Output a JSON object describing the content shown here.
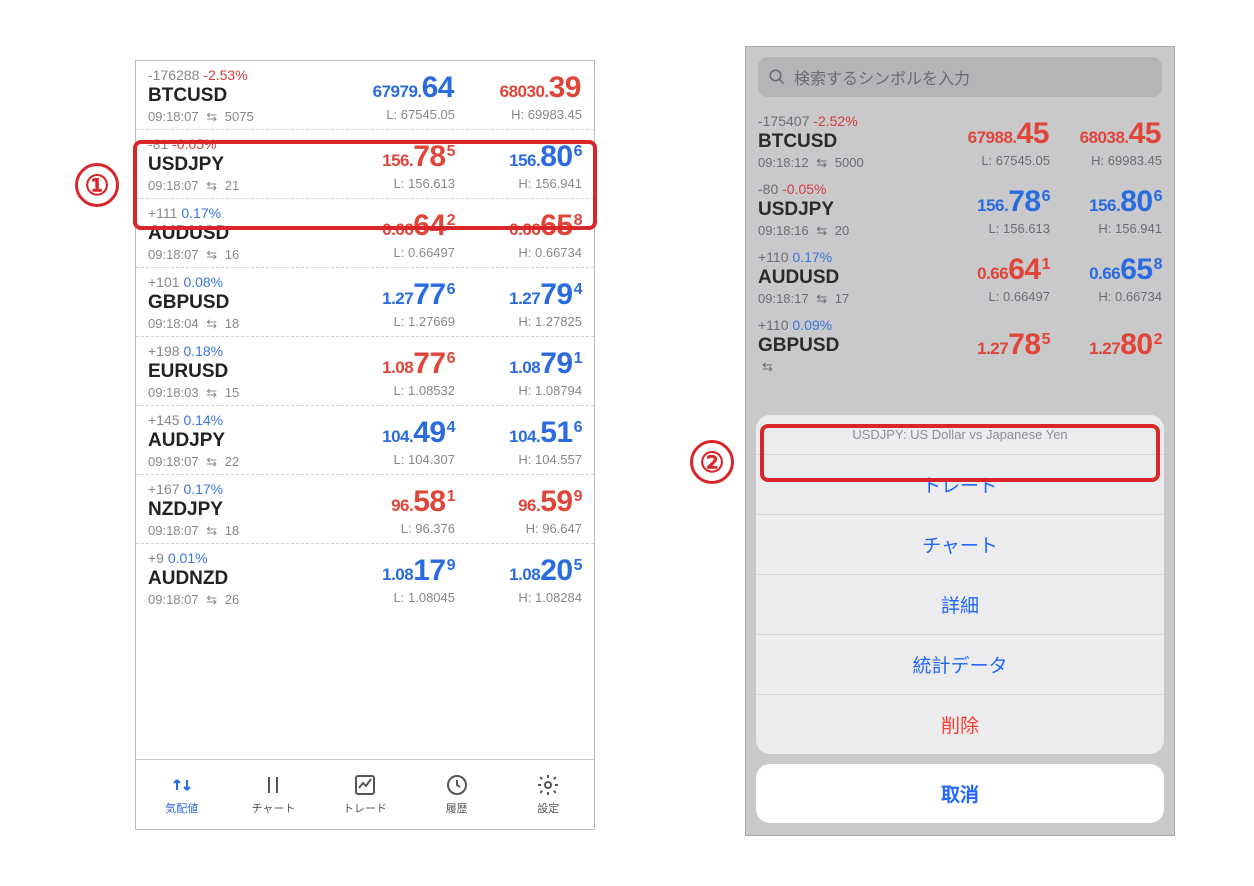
{
  "annotations": {
    "one": "①",
    "two": "②"
  },
  "phone1": {
    "rows": [
      {
        "chg": "-176288",
        "pct": "-2.53%",
        "pcls": "neg",
        "sym": "BTCUSD",
        "time": "09:18:07",
        "spread": "5075",
        "sell_pre": "67979.",
        "sell_main": "64",
        "sell_sup": "",
        "sell_cls": "blue",
        "buy_pre": "68030.",
        "buy_main": "39",
        "buy_sup": "",
        "buy_cls": "red",
        "low": "L: 67545.05",
        "high": "H: 69983.45"
      },
      {
        "chg": "-81",
        "pct": "-0.05%",
        "pcls": "neg",
        "sym": "USDJPY",
        "time": "09:18:07",
        "spread": "21",
        "sell_pre": "156.",
        "sell_main": "78",
        "sell_sup": "5",
        "sell_cls": "red",
        "buy_pre": "156.",
        "buy_main": "80",
        "buy_sup": "6",
        "buy_cls": "blue",
        "low": "L: 156.613",
        "high": "H: 156.941"
      },
      {
        "chg": "+111",
        "pct": "0.17%",
        "pcls": "pos",
        "sym": "AUDUSD",
        "time": "09:18:07",
        "spread": "16",
        "sell_pre": "0.66",
        "sell_main": "64",
        "sell_sup": "2",
        "sell_cls": "red",
        "buy_pre": "0.66",
        "buy_main": "65",
        "buy_sup": "8",
        "buy_cls": "red",
        "low": "L: 0.66497",
        "high": "H: 0.66734"
      },
      {
        "chg": "+101",
        "pct": "0.08%",
        "pcls": "pos",
        "sym": "GBPUSD",
        "time": "09:18:04",
        "spread": "18",
        "sell_pre": "1.27",
        "sell_main": "77",
        "sell_sup": "6",
        "sell_cls": "blue",
        "buy_pre": "1.27",
        "buy_main": "79",
        "buy_sup": "4",
        "buy_cls": "blue",
        "low": "L: 1.27669",
        "high": "H: 1.27825"
      },
      {
        "chg": "+198",
        "pct": "0.18%",
        "pcls": "pos",
        "sym": "EURUSD",
        "time": "09:18:03",
        "spread": "15",
        "sell_pre": "1.08",
        "sell_main": "77",
        "sell_sup": "6",
        "sell_cls": "red",
        "buy_pre": "1.08",
        "buy_main": "79",
        "buy_sup": "1",
        "buy_cls": "blue",
        "low": "L: 1.08532",
        "high": "H: 1.08794"
      },
      {
        "chg": "+145",
        "pct": "0.14%",
        "pcls": "pos",
        "sym": "AUDJPY",
        "time": "09:18:07",
        "spread": "22",
        "sell_pre": "104.",
        "sell_main": "49",
        "sell_sup": "4",
        "sell_cls": "blue",
        "buy_pre": "104.",
        "buy_main": "51",
        "buy_sup": "6",
        "buy_cls": "blue",
        "low": "L: 104.307",
        "high": "H: 104.557"
      },
      {
        "chg": "+167",
        "pct": "0.17%",
        "pcls": "pos",
        "sym": "NZDJPY",
        "time": "09:18:07",
        "spread": "18",
        "sell_pre": "96.",
        "sell_main": "58",
        "sell_sup": "1",
        "sell_cls": "red",
        "buy_pre": "96.",
        "buy_main": "59",
        "buy_sup": "9",
        "buy_cls": "red",
        "low": "L: 96.376",
        "high": "H: 96.647"
      },
      {
        "chg": "+9",
        "pct": "0.01%",
        "pcls": "pos",
        "sym": "AUDNZD",
        "time": "09:18:07",
        "spread": "26",
        "sell_pre": "1.08",
        "sell_main": "17",
        "sell_sup": "9",
        "sell_cls": "blue",
        "buy_pre": "1.08",
        "buy_main": "20",
        "buy_sup": "5",
        "buy_cls": "blue",
        "low": "L: 1.08045",
        "high": "H: 1.08284"
      }
    ],
    "tabs": {
      "quotes": "気配値",
      "chart": "チャート",
      "trade": "トレード",
      "history": "履歴",
      "settings": "設定"
    }
  },
  "phone2": {
    "search_placeholder": "検索するシンボルを入力",
    "rows": [
      {
        "chg": "-175407",
        "pct": "-2.52%",
        "pcls": "neg",
        "sym": "BTCUSD",
        "time": "09:18:12",
        "spread": "5000",
        "sell_pre": "67988.",
        "sell_main": "45",
        "sell_sup": "",
        "sell_cls": "red",
        "buy_pre": "68038.",
        "buy_main": "45",
        "buy_sup": "",
        "buy_cls": "red",
        "low": "L: 67545.05",
        "high": "H: 69983.45"
      },
      {
        "chg": "-80",
        "pct": "-0.05%",
        "pcls": "neg",
        "sym": "USDJPY",
        "time": "09:18:16",
        "spread": "20",
        "sell_pre": "156.",
        "sell_main": "78",
        "sell_sup": "6",
        "sell_cls": "blue",
        "buy_pre": "156.",
        "buy_main": "80",
        "buy_sup": "6",
        "buy_cls": "blue",
        "low": "L: 156.613",
        "high": "H: 156.941"
      },
      {
        "chg": "+110",
        "pct": "0.17%",
        "pcls": "pos",
        "sym": "AUDUSD",
        "time": "09:18:17",
        "spread": "17",
        "sell_pre": "0.66",
        "sell_main": "64",
        "sell_sup": "1",
        "sell_cls": "red",
        "buy_pre": "0.66",
        "buy_main": "65",
        "buy_sup": "8",
        "buy_cls": "blue",
        "low": "L: 0.66497",
        "high": "H: 0.66734"
      },
      {
        "chg": "+110",
        "pct": "0.09%",
        "pcls": "pos",
        "sym": "GBPUSD",
        "time": "",
        "spread": "",
        "sell_pre": "1.27",
        "sell_main": "78",
        "sell_sup": "5",
        "sell_cls": "red",
        "buy_pre": "1.27",
        "buy_main": "80",
        "buy_sup": "2",
        "buy_cls": "red",
        "low": "",
        "high": ""
      }
    ],
    "sheet": {
      "title": "USDJPY: US Dollar vs Japanese Yen",
      "trade": "トレード",
      "chart": "チャート",
      "detail": "詳細",
      "stats": "統計データ",
      "delete": "削除",
      "cancel": "取消"
    }
  }
}
